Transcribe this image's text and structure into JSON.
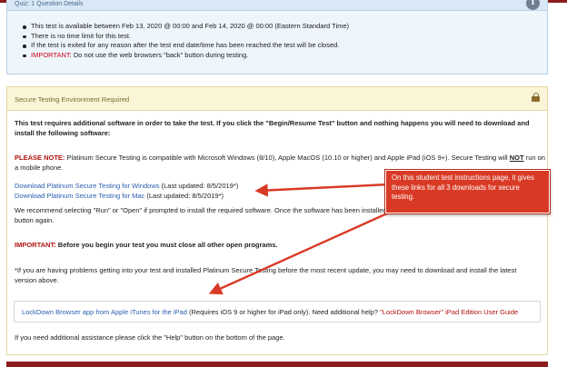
{
  "quiz_panel": {
    "header_title": "Quiz: 1 Question Details",
    "info_icon": "info-icon",
    "bullets": [
      "This test is available between Feb 13, 2020 @ 00:00 and Feb 14, 2020 @ 00:00 (Eastern Standard Time)",
      "There is no time limit for this test.",
      "If the test is exited for any reason after the test end date/time has been reached the test will be closed."
    ],
    "important_label": "IMPORTANT:",
    "important_text": " Do not use the web browsers \"back\" button during testing."
  },
  "secure_panel": {
    "header_title": "Secure Testing Environment Required",
    "lock_icon": "lock-icon",
    "intro_line1": "This test requires additional software in order to take the test. If you click the \"Begin/Resume Test\" button and nothing happens you will need to download and",
    "intro_line2": "install the following software:",
    "please_note_label": "PLEASE NOTE:",
    "please_note_text": " Platinum Secure Testing is compatible with Microsoft Windows (8/10), Apple MacOS (10.10 or higher) and Apple iPad (iOS 9+). Secure Testing will ",
    "please_note_not": "NOT",
    "please_note_end": " run on",
    "please_note_line2": "a mobile phone.",
    "download_windows_link": "Download Platinum Secure Testing for Windows",
    "download_windows_updated": " (Last updated: 8/5/2019*)",
    "download_mac_link": "Download Platinum Secure Testing for Mac",
    "download_mac_updated": " (Last updated: 8/5/2019*)",
    "recommend_line1": "We recommend selecting \"Run\" or \"Open\" if prompted to install the required software. Once the software has been installed, please try clicking the",
    "recommend_line2": "button again.",
    "important_label": "IMPORTANT:",
    "important_text": " Before you begin your test you must close all other open programs.",
    "problems_line1": "*If you are having problems getting into your test and installed Platinum Secure Testing before the most recent update, you may need to download and install the latest",
    "problems_line2": "version above.",
    "lockdown_link": "LockDown Browser app from Apple iTunes for the iPad",
    "lockdown_text": " (Requires iOS 9 or higher for iPad only). Need additional help? ",
    "lockdown_guide_link": "\"LockDown Browser\" iPad Edition User Guide",
    "help_line": "If you need additional assistance please click the \"Help\" button on the bottom of the page."
  },
  "callout": {
    "text": "On this student test instructions page, it gives these links for all 3 downloads for secure testing.",
    "background": "#d93a25"
  },
  "colors": {
    "accent_dark_red": "#8b1c1c",
    "link_blue": "#2a5db0",
    "important_red": "#d0021b"
  }
}
